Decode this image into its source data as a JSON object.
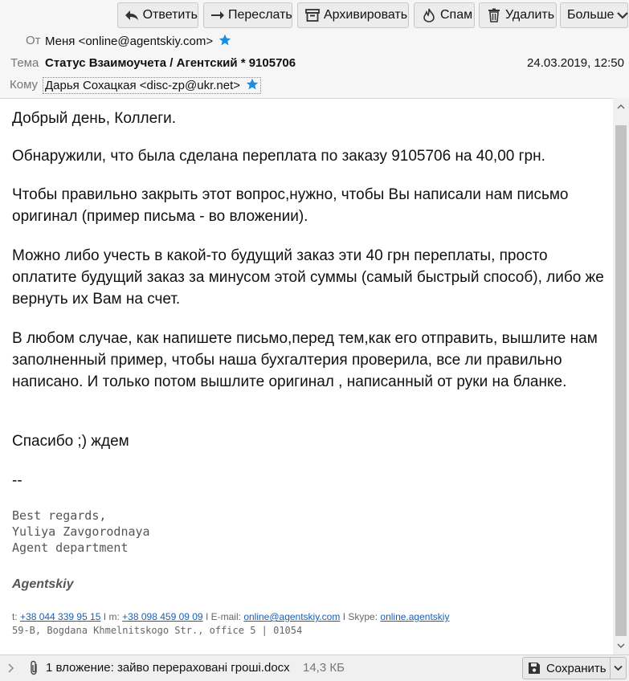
{
  "toolbar": {
    "reply": "Ответить",
    "forward": "Переслать",
    "archive": "Архивировать",
    "spam": "Спам",
    "delete": "Удалить",
    "more": "Больше"
  },
  "header": {
    "from_label": "От",
    "from_value": "Меня <online@agentskiy.com>",
    "subject_label": "Тема",
    "subject_value": "Статус Взаимоучета / Агентский * 9105706",
    "date": "24.03.2019, 12:50",
    "to_label": "Кому",
    "to_value": "Дарья Сохацкая <disc-zp@ukr.net>"
  },
  "body": {
    "p1": "Добрый день, Коллеги.",
    "p2": "Обнаружили, что была сделана переплата по заказу  9105706 на 40,00 грн.",
    "p3": "Чтобы правильно закрыть этот вопрос,нужно, чтобы Вы написали нам письмо оригинал (пример письма - во вложении).",
    "p4": "Можно либо учесть в какой-то будущий заказ эти 40 грн переплаты, просто оплатите будущий заказ за минусом этой суммы (самый быстрый способ), либо же вернуть их Вам на счет.",
    "p5": "В любом случае, как напишете письмо,перед тем,как его отправить, вышлите нам заполненный пример, чтобы наша бухгалтерия проверила, все ли правильно написано. И только потом вышлите оригинал , написанный от руки на бланке.",
    "p6": "Спасибо ;) ждем",
    "sep": "--"
  },
  "signature": {
    "line1": "Best regards,",
    "line2": "Yuliya Zavgorodnaya",
    "line3": "Agent department",
    "brand": "Agentskiy",
    "t_label": "t:",
    "phone1": "+38 044 339 95 15",
    "sep1": "I",
    "m_label": "m:",
    "phone2": "+38 098 459 09 09",
    "email_label": "I E-mail:",
    "email": "online@agentskiy.com",
    "skype_label": "I Skype:",
    "skype": "online.agentskiy",
    "address": "59-B, Bogdana Khmelnitskogo Str., office 5 | 01054"
  },
  "attachment": {
    "text": "1 вложение: зайво перераховані гроші.docx",
    "size": "14,3 КБ",
    "save": "Сохранить"
  },
  "colors": {
    "link": "#1a5fb4",
    "star": "#1a8fe0",
    "scroll_thumb": "#c2c2c2"
  }
}
